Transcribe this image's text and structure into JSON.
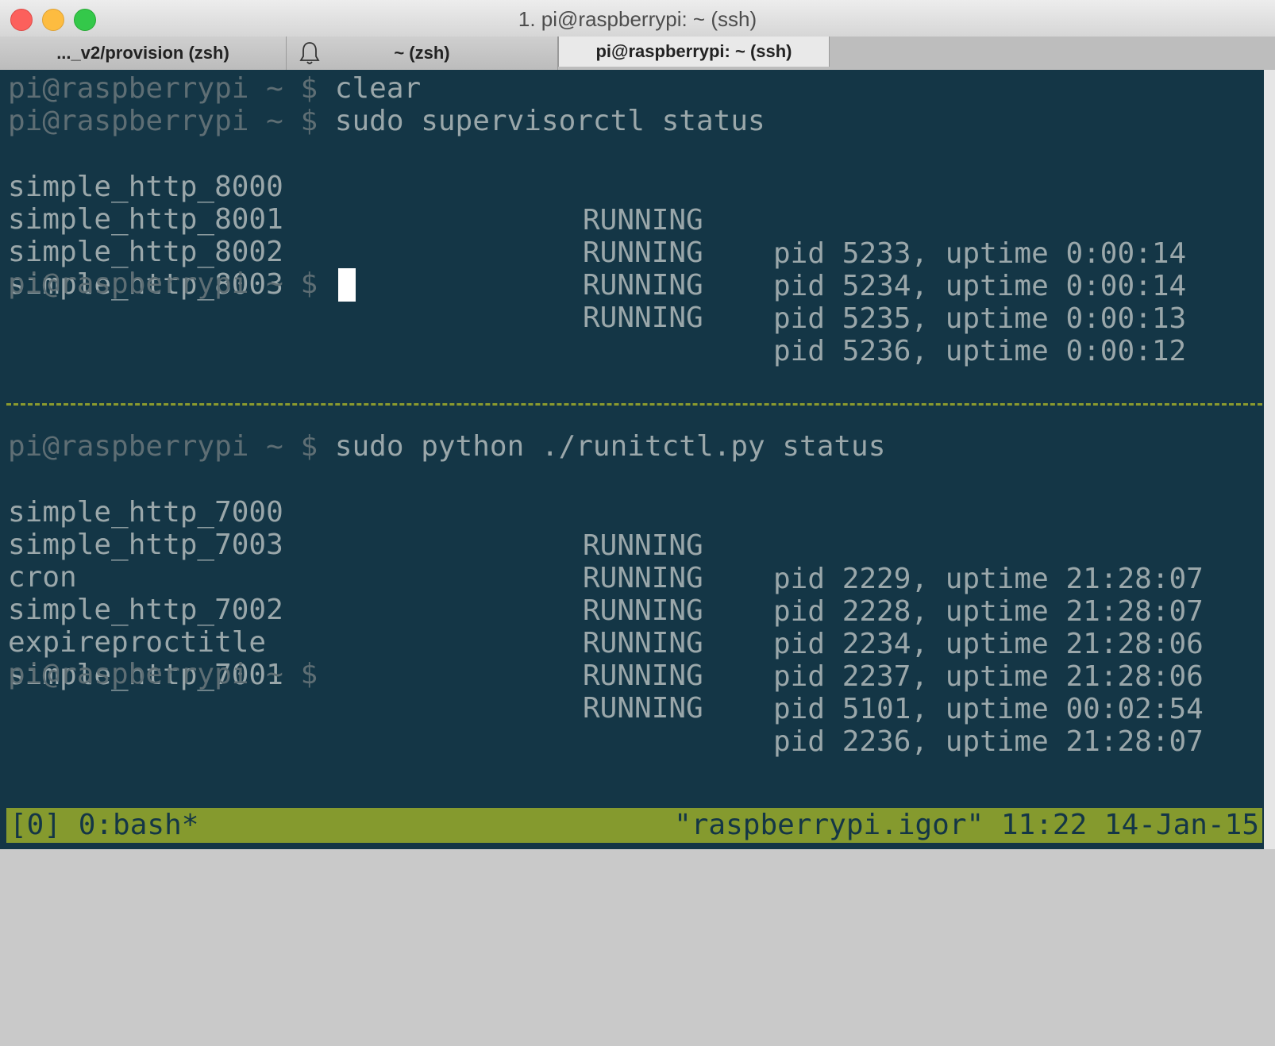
{
  "window": {
    "title": "1. pi@raspberrypi: ~ (ssh)"
  },
  "tabs": [
    {
      "label": "..._v2/provision (zsh)"
    },
    {
      "label": "~ (zsh)",
      "icon": "bell-icon"
    },
    {
      "label": "pi@raspberrypi: ~ (ssh)",
      "active": true
    }
  ],
  "pane1": {
    "prompt": "pi@raspberrypi ~ $",
    "cmd1": "clear",
    "cmd2": "sudo supervisorctl status",
    "rows": [
      {
        "name": "simple_http_8000",
        "state": "RUNNING",
        "info": "pid 5233, uptime 0:00:14"
      },
      {
        "name": "simple_http_8001",
        "state": "RUNNING",
        "info": "pid 5234, uptime 0:00:14"
      },
      {
        "name": "simple_http_8002",
        "state": "RUNNING",
        "info": "pid 5235, uptime 0:00:13"
      },
      {
        "name": "simple_http_8003",
        "state": "RUNNING",
        "info": "pid 5236, uptime 0:00:12"
      }
    ]
  },
  "pane2": {
    "prompt": "pi@raspberrypi ~ $",
    "cmd": "sudo python ./runitctl.py status",
    "rows": [
      {
        "name": "simple_http_7000",
        "state": "RUNNING",
        "info": "pid 2229, uptime 21:28:07"
      },
      {
        "name": "simple_http_7003",
        "state": "RUNNING",
        "info": "pid 2228, uptime 21:28:07"
      },
      {
        "name": "cron",
        "state": "RUNNING",
        "info": "pid 2234, uptime 21:28:06"
      },
      {
        "name": "simple_http_7002",
        "state": "RUNNING",
        "info": "pid 2237, uptime 21:28:06"
      },
      {
        "name": "expireproctitle",
        "state": "RUNNING",
        "info": "pid 5101, uptime 00:02:54"
      },
      {
        "name": "simple_http_7001",
        "state": "RUNNING",
        "info": "pid 2236, uptime 21:28:07"
      }
    ]
  },
  "statusbar": {
    "left": "[0] 0:bash*",
    "right": "\"raspberrypi.igor\" 11:22 14-Jan-15"
  },
  "colors": {
    "terminal_bg": "#143646",
    "status_bg": "#859a2e",
    "divider": "#8b9a2e"
  }
}
